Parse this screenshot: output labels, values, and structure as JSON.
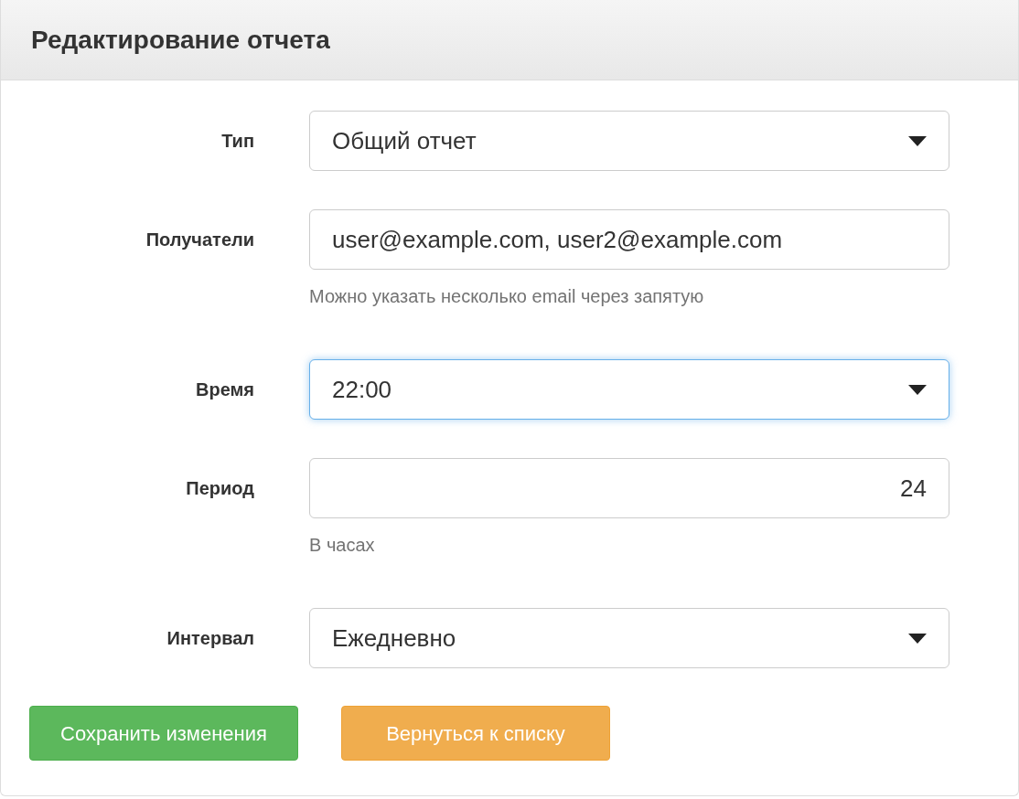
{
  "panel": {
    "title": "Редактирование отчета"
  },
  "fields": [
    {
      "label": "Тип",
      "kind": "select",
      "value": "Общий отчет",
      "focused": false
    },
    {
      "label": "Получатели",
      "kind": "text",
      "value": "user@example.com, user2@example.com",
      "help": "Можно указать несколько email через запятую",
      "focused": false
    },
    {
      "label": "Время",
      "kind": "select",
      "value": "22:00",
      "focused": true
    },
    {
      "label": "Период",
      "kind": "number",
      "value": "24",
      "help": "В часах",
      "focused": false
    },
    {
      "label": "Интервал",
      "kind": "select",
      "value": "Ежедневно",
      "focused": false
    }
  ],
  "buttons": [
    {
      "label": "Сохранить изменения",
      "kind": "success"
    },
    {
      "label": "Вернуться к списку",
      "kind": "warning"
    }
  ]
}
